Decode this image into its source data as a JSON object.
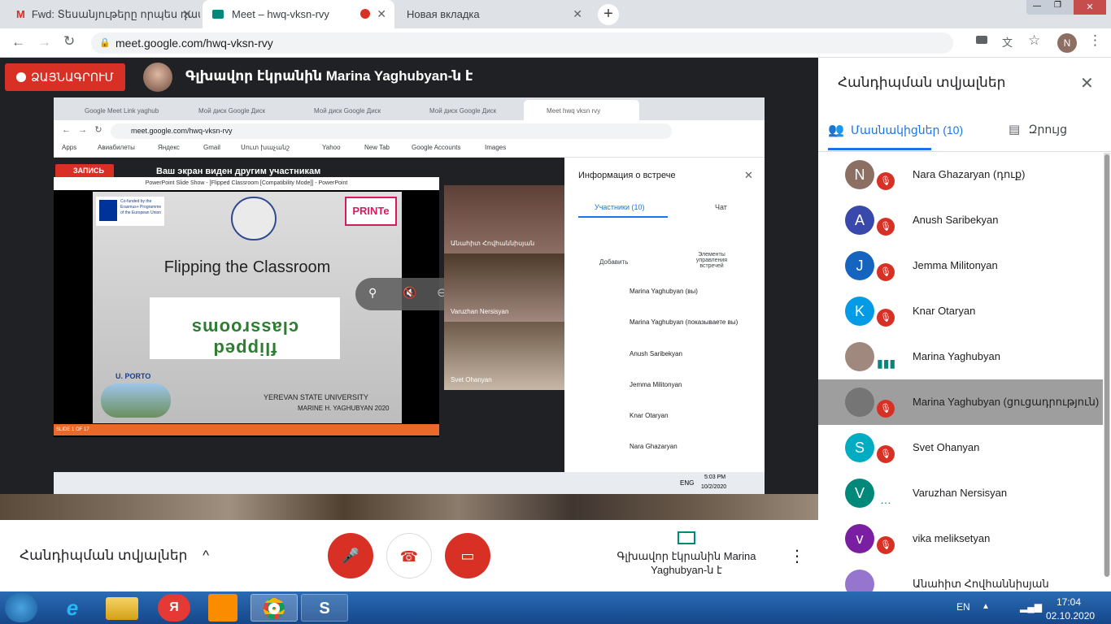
{
  "browser": {
    "tabs": [
      {
        "title": "Fwd: Տեսանյութերը որպես դաս",
        "icon": "gmail-icon"
      },
      {
        "title": "Meet – hwq-vksn-rvy",
        "icon": "meet-icon"
      },
      {
        "title": "Новая вкладка",
        "icon": "newtab-icon"
      }
    ],
    "url": "meet.google.com/hwq-vksn-rvy",
    "profile_initial": "N"
  },
  "meet": {
    "record_label": "ՁԱՅՆԱԳՐՈՒՄ",
    "presenter_banner": "Գլխավոր էկրանին Marina Yaghubyan-ն է",
    "inner": {
      "tabs": [
        "Google Meet Link yaghub",
        "Мой диск Google Диск",
        "Мой диск Google Диск",
        "Мой диск Google Диск",
        "Meet hwq vksn rvy"
      ],
      "url": "meet.google.com/hwq-vksn-rvy",
      "bookmarks": [
        "Apps",
        "Авиабилеты",
        "Яндекс",
        "Gmail",
        "Սուտ խաչանշ",
        "Yahoo",
        "New Tab",
        "Google Accounts",
        "Images"
      ],
      "record_label": "ЗАПИСЬ",
      "present_banner": "Ваш экран виден другим участникам",
      "ppt_title": "PowerPoint Slide Show - [Flipped Classroom [Compatibility Mode]] - PowerPoint",
      "slide": {
        "erasmus": "Co-funded by the Erasmus+ Programme of the European Union",
        "heading": "Flipping the Classroom",
        "flipped_text_1": "flipped",
        "flipped_text_2": "classrooms",
        "porto": "U. PORTO",
        "university": "YEREVAN STATE UNIVERSITY",
        "author": "MARINE H. YAGHUBYAN 2020",
        "status": "SLIDE 1 OF 17"
      },
      "tiles": [
        "Անահիտ Հովհաննիսյան",
        "Varuzhan Nersisyan",
        "Svet Ohanyan"
      ],
      "panel": {
        "title": "Информация о встрече",
        "tab_people": "Участники (10)",
        "tab_chat": "Чат",
        "add": "Добавить",
        "controls": "Элементы управления встречей",
        "people": [
          "Marina Yaghubyan (вы)",
          "Marina Yaghubyan (показываете вы)",
          "Anush Saribekyan",
          "Jemma Militonyan",
          "Knar Otaryan",
          "Nara Ghazaryan"
        ]
      },
      "taskbar_lang": "ENG",
      "taskbar_time": "5:03 PM",
      "taskbar_date": "10/2/2020"
    },
    "controls": {
      "meeting_details": "Հանդիպման տվյալներ",
      "presenting": "Գլխավոր էկրանին Marina Yaghubyan-ն է"
    },
    "panel": {
      "title": "Հանդիպման տվյալներ",
      "tab_people": "Մասնակիցներ (10)",
      "tab_chat": "Զրույց",
      "participants": [
        {
          "name": "Nara Ghazaryan (դուք)",
          "initial": "N",
          "color": "#8d6e63",
          "muted": true
        },
        {
          "name": "Anush Saribekyan",
          "initial": "A",
          "color": "#3949ab",
          "muted": true
        },
        {
          "name": "Jemma Militonyan",
          "initial": "J",
          "color": "#1565c0",
          "muted": true
        },
        {
          "name": "Knar Otaryan",
          "initial": "K",
          "color": "#039be5",
          "muted": true
        },
        {
          "name": "Marina Yaghubyan",
          "initial": "",
          "color": "#a1887f",
          "muted": false
        },
        {
          "name": "Marina Yaghubyan (ցուցադրություն)",
          "initial": "",
          "color": "#757575",
          "muted": true
        },
        {
          "name": "Svet Ohanyan",
          "initial": "S",
          "color": "#00acc1",
          "muted": true
        },
        {
          "name": "Varuzhan Nersisyan",
          "initial": "V",
          "color": "#00897b",
          "muted": false
        },
        {
          "name": "vika meliksetyan",
          "initial": "v",
          "color": "#7b1fa2",
          "muted": true
        },
        {
          "name": "Անահիտ Հովհաննիսյան",
          "initial": "",
          "color": "#9575cd",
          "muted": false
        }
      ]
    }
  },
  "taskbar": {
    "lang": "EN",
    "time": "17:04",
    "date": "02.10.2020"
  },
  "colors": {
    "accent": "#1a73e8",
    "red": "#d93025",
    "panel_text": "#202124"
  }
}
